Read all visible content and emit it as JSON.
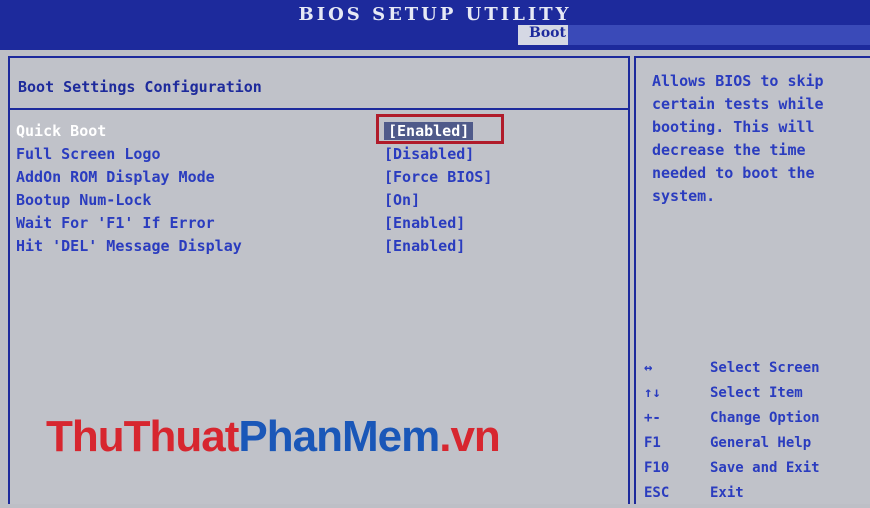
{
  "header": {
    "title": "BIOS SETUP UTILITY",
    "active_tab": "Boot"
  },
  "main": {
    "section_title": "Boot Settings Configuration",
    "settings": [
      {
        "label": "Quick Boot",
        "value": "[Enabled]",
        "selected": true
      },
      {
        "label": "Full Screen Logo",
        "value": "[Disabled]"
      },
      {
        "label": "AddOn ROM Display Mode",
        "value": "[Force BIOS]"
      },
      {
        "label": "Bootup Num-Lock",
        "value": "[On]"
      },
      {
        "label": "Wait For 'F1' If Error",
        "value": "[Enabled]"
      },
      {
        "label": "Hit 'DEL' Message Display",
        "value": "[Enabled]"
      }
    ]
  },
  "help": {
    "lines": [
      "Allows BIOS to skip",
      "certain tests while",
      "booting. This will",
      "decrease the time",
      "needed to boot the",
      "system."
    ],
    "keys": [
      {
        "key": "↔",
        "desc": "Select Screen"
      },
      {
        "key": "↑↓",
        "desc": "Select Item"
      },
      {
        "key": "+-",
        "desc": "Change Option"
      },
      {
        "key": "F1",
        "desc": "General Help"
      },
      {
        "key": "F10",
        "desc": "Save and Exit"
      },
      {
        "key": "ESC",
        "desc": "Exit"
      }
    ]
  },
  "watermark": {
    "part1": "ThuThuat",
    "part2": "PhanMem",
    "part3": ".vn"
  },
  "colors": {
    "header_bg": "#1d2a9c",
    "text_blue": "#2a3cbf",
    "highlight_red": "#b01b2a",
    "panel_bg": "#c0c2c9"
  }
}
